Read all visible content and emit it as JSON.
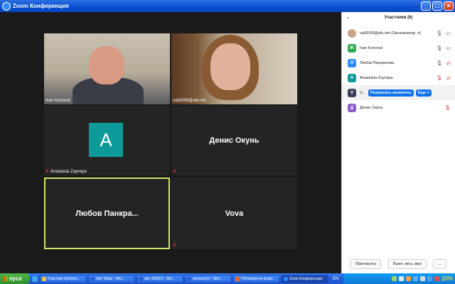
{
  "window": {
    "title": "Zoom Конференция"
  },
  "tiles": [
    {
      "name": "Ivan Konoval",
      "muted": false
    },
    {
      "name": "vali2009@ukr.net",
      "muted": false
    },
    {
      "name": "Anastasia Zayvaya",
      "avatar_letter": "A",
      "muted": true
    },
    {
      "name": "Денис Окунь",
      "muted": true
    },
    {
      "name": "Любов  Панкра...",
      "muted": false
    },
    {
      "name": "Vova",
      "muted": true
    }
  ],
  "panel": {
    "title": "Участники (6)",
    "participants": [
      {
        "name": "vali2009@ukr.net (Организатор, я)",
        "letter": "",
        "color": "#c9a38a"
      },
      {
        "name": "Ivan Konoval",
        "letter": "IK",
        "color": "#2fa84f"
      },
      {
        "name": "Любов Панкратова",
        "letter": "Л",
        "color": "#2d8cff"
      },
      {
        "name": "Anastasia Zayvaya",
        "letter": "A",
        "color": "#0f9a9a"
      },
      {
        "name": "V...",
        "letter": "V",
        "color": "#3a3f5a"
      },
      {
        "name": "Денис Окунь",
        "letter": "Д",
        "color": "#8a5cc7"
      }
    ],
    "ask_unmute_label": "Попросить включить",
    "more_label": "Еще >",
    "invite_label": "Пригласить",
    "mute_all_label": "Выкл. весь звук",
    "more_dots": "..."
  },
  "taskbar": {
    "start_label": "пуск",
    "tasks": [
      "Участник публичн...",
      "Звіт Заїва - Micr...",
      "звіт 2020(1) - Mic...",
      "питання(1) - Micr...",
      "Обговорення конф...",
      "Zoom Конференция"
    ],
    "lang": "EN",
    "clock": "10%"
  },
  "colors": {
    "accent": "#0e72ed",
    "active_speaker": "#cfe66a",
    "mute_red": "#e0383b"
  }
}
